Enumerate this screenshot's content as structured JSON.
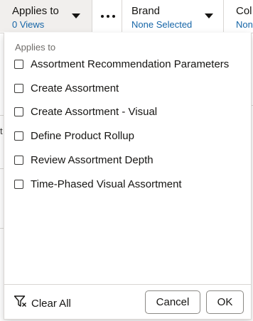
{
  "filterbar": {
    "applies_to": {
      "title": "Applies to",
      "value": "0 Views"
    },
    "brand": {
      "title": "Brand",
      "value": "None Selected"
    },
    "col": {
      "title": "Col",
      "value": "Non"
    }
  },
  "popup": {
    "header": "Applies to",
    "options": [
      {
        "label": "Assortment Recommendation Parameters",
        "checked": false
      },
      {
        "label": "Create Assortment",
        "checked": false
      },
      {
        "label": "Create Assortment - Visual",
        "checked": false
      },
      {
        "label": "Define Product Rollup",
        "checked": false
      },
      {
        "label": "Review Assortment Depth",
        "checked": false
      },
      {
        "label": "Time-Phased Visual Assortment",
        "checked": false
      }
    ],
    "clear_all": "Clear All",
    "cancel": "Cancel",
    "ok": "OK"
  },
  "background": {
    "partial_char": "t"
  },
  "colors": {
    "link": "#1565a7",
    "border": "#d9d6d3",
    "active_chip": "#f1efed"
  }
}
